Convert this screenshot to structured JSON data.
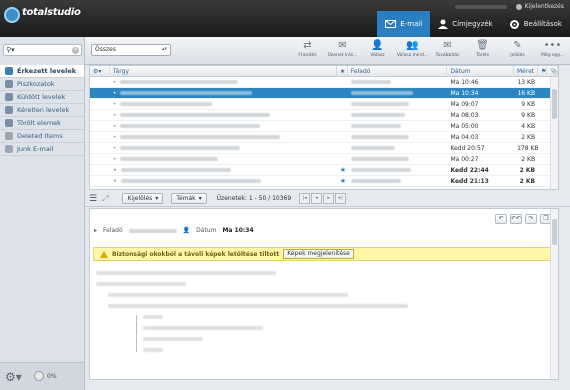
{
  "app": {
    "logo_text": "totalstudio",
    "logout_label": "Kijelentkezés"
  },
  "nav": [
    {
      "label": "E-mail",
      "icon": "envelope-icon",
      "active": true
    },
    {
      "label": "Címjegyzék",
      "icon": "person-icon",
      "active": false
    },
    {
      "label": "Beállítások",
      "icon": "gear-icon",
      "active": false
    }
  ],
  "sidebar": {
    "search_placeholder": "",
    "folders": [
      {
        "label": "Érkezett levelek",
        "icon": "inbox-icon",
        "active": true
      },
      {
        "label": "Piszkozatok",
        "icon": "pencil-icon",
        "active": false
      },
      {
        "label": "Küldött levelek",
        "icon": "sent-icon",
        "active": false
      },
      {
        "label": "Kéretlen levelek",
        "icon": "junk-icon",
        "active": false
      },
      {
        "label": "Törölt elemek",
        "icon": "trash-icon",
        "active": false
      },
      {
        "label": "Deleted Items",
        "icon": "folder-icon",
        "active": false
      },
      {
        "label": "Junk E-mail",
        "icon": "folder-icon",
        "active": false
      }
    ],
    "quota": "0%"
  },
  "toolbar": {
    "filter_value": "Összes",
    "tools": [
      {
        "label": "Frissítés",
        "icon": "refresh-icon"
      },
      {
        "label": "Üzenet írás...",
        "icon": "compose-icon"
      },
      {
        "label": "Válasz",
        "icon": "reply-icon"
      },
      {
        "label": "Válasz mind...",
        "icon": "reply-all-icon"
      },
      {
        "label": "Továbbítás",
        "icon": "forward-icon"
      },
      {
        "label": "Törlés",
        "icon": "delete-icon"
      },
      {
        "label": "Jelölés",
        "icon": "mark-icon"
      },
      {
        "label": "Még egy...",
        "icon": "more-icon"
      }
    ]
  },
  "list": {
    "columns": {
      "subject": "Tárgy",
      "from": "Feladó",
      "date": "Dátum",
      "size": "Méret"
    },
    "rows": [
      {
        "date": "Ma 10:46",
        "size": "13 KB",
        "selected": false,
        "bold": false,
        "starred": false
      },
      {
        "date": "Ma 10:34",
        "size": "16 KB",
        "selected": true,
        "bold": false,
        "starred": false
      },
      {
        "date": "Ma 09:07",
        "size": "9 KB",
        "selected": false,
        "bold": false,
        "starred": false
      },
      {
        "date": "Ma 08:03",
        "size": "9 KB",
        "selected": false,
        "bold": false,
        "starred": false
      },
      {
        "date": "Ma 05:00",
        "size": "4 KB",
        "selected": false,
        "bold": false,
        "starred": false
      },
      {
        "date": "Ma 04:03",
        "size": "2 KB",
        "selected": false,
        "bold": false,
        "starred": false
      },
      {
        "date": "Kedd 20:57",
        "size": "178 KB",
        "selected": false,
        "bold": false,
        "starred": false
      },
      {
        "date": "Ma 00:27",
        "size": "2 KB",
        "selected": false,
        "bold": false,
        "starred": false
      },
      {
        "date": "Kedd 22:44",
        "size": "2 KB",
        "selected": false,
        "bold": true,
        "starred": true
      },
      {
        "date": "Kedd 21:13",
        "size": "2 KB",
        "selected": false,
        "bold": true,
        "starred": true
      }
    ]
  },
  "pager": {
    "select_label": "Kijelölés",
    "threads_label": "Témák",
    "info": "Üzenetek: 1 - 50 / 10369"
  },
  "preview": {
    "from_label": "Feladó",
    "date_label": "Dátum",
    "date_value": "Ma 10:34",
    "warning": "Biztonsági okokból a távoli képek letöltése tiltott",
    "show_images": "Képek megjelenítése"
  }
}
